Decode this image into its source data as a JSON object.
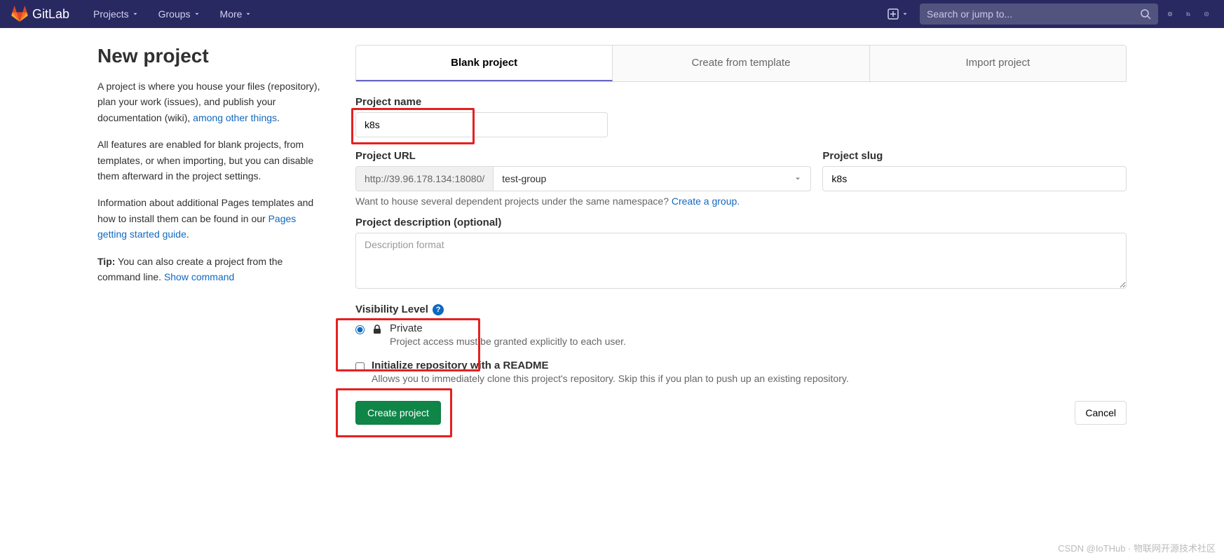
{
  "navbar": {
    "brand": "GitLab",
    "items": [
      "Projects",
      "Groups",
      "More"
    ],
    "search_placeholder": "Search or jump to..."
  },
  "sidebar": {
    "title": "New project",
    "p1_a": "A project is where you house your files (repository), plan your work (issues), and publish your documentation (wiki), ",
    "p1_link": "among other things",
    "p1_b": ".",
    "p2": "All features are enabled for blank projects, from templates, or when importing, but you can disable them afterward in the project settings.",
    "p3_a": "Information about additional Pages templates and how to install them can be found in our ",
    "p3_link": "Pages getting started guide",
    "p3_b": ".",
    "tip_label": "Tip:",
    "tip_a": " You can also create a project from the command line. ",
    "tip_link": "Show command"
  },
  "tabs": {
    "blank": "Blank project",
    "template": "Create from template",
    "import": "Import project"
  },
  "form": {
    "name_label": "Project name",
    "name_value": "k8s",
    "url_label": "Project URL",
    "url_prefix": "http://39.96.178.134:18080/",
    "url_namespace": "test-group",
    "slug_label": "Project slug",
    "slug_value": "k8s",
    "namespace_hint_a": "Want to house several dependent projects under the same namespace? ",
    "namespace_hint_link": "Create a group.",
    "desc_label": "Project description (optional)",
    "desc_placeholder": "Description format",
    "vis_label": "Visibility Level",
    "vis_private_title": "Private",
    "vis_private_desc": "Project access must be granted explicitly to each user.",
    "readme_title": "Initialize repository with a README",
    "readme_desc": "Allows you to immediately clone this project's repository. Skip this if you plan to push up an existing repository.",
    "submit": "Create project",
    "cancel": "Cancel"
  },
  "watermark": "CSDN @IoTHub · 物联网开源技术社区"
}
